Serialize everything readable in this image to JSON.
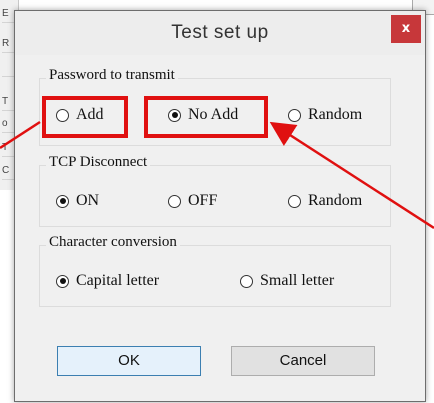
{
  "background": {
    "fragments": [
      "E",
      "R",
      "",
      "T",
      "o",
      "T",
      "C"
    ]
  },
  "dialog": {
    "title": "Test set up",
    "close_glyph": "x",
    "groups": {
      "password": {
        "label": "Password to transmit",
        "options": [
          {
            "label": "Add",
            "checked": false
          },
          {
            "label": "No Add",
            "checked": true
          },
          {
            "label": "Random",
            "checked": false
          }
        ]
      },
      "tcp": {
        "label": "TCP Disconnect",
        "options": [
          {
            "label": "ON",
            "checked": true
          },
          {
            "label": "OFF",
            "checked": false
          },
          {
            "label": "Random",
            "checked": false
          }
        ]
      },
      "charconv": {
        "label": "Character conversion",
        "options": [
          {
            "label": "Capital letter",
            "checked": true
          },
          {
            "label": "Small letter",
            "checked": false
          }
        ]
      }
    },
    "buttons": {
      "ok": "OK",
      "cancel": "Cancel"
    }
  },
  "colors": {
    "highlight": "#e01010",
    "close_button": "#c7373a",
    "dialog_bg": "#f0f0f0"
  }
}
